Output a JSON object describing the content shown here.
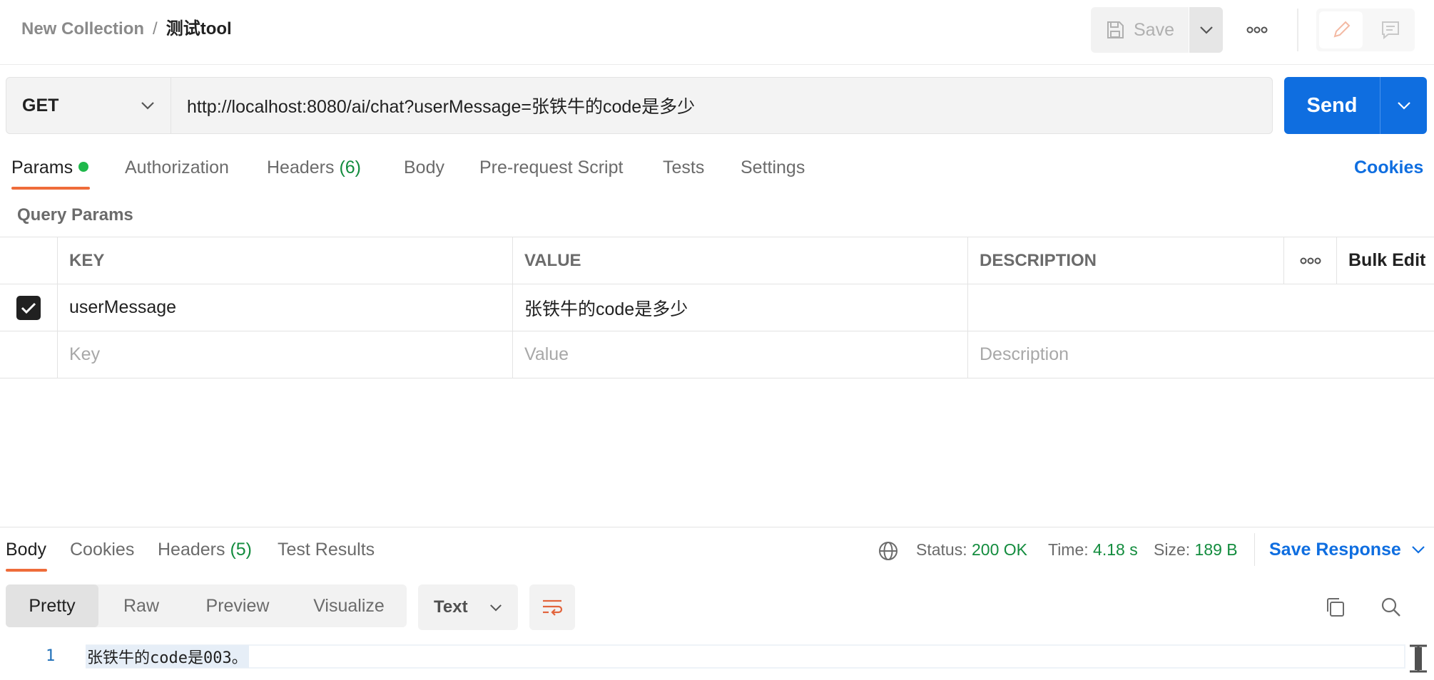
{
  "header": {
    "collection": "New Collection",
    "separator": "/",
    "request_name": "测试tool",
    "save_label": "Save"
  },
  "request": {
    "method": "GET",
    "url": "http://localhost:8080/ai/chat?userMessage=张铁牛的code是多少",
    "send_label": "Send"
  },
  "request_tabs": {
    "params": "Params",
    "authorization": "Authorization",
    "headers": "Headers",
    "headers_count": "(6)",
    "body": "Body",
    "pre_request": "Pre-request Script",
    "tests": "Tests",
    "settings": "Settings",
    "cookies": "Cookies"
  },
  "query_params": {
    "label": "Query Params",
    "columns": {
      "key": "KEY",
      "value": "VALUE",
      "description": "DESCRIPTION",
      "bulk_edit": "Bulk Edit"
    },
    "rows": [
      {
        "checked": true,
        "key": "userMessage",
        "value": "张铁牛的code是多少",
        "description": ""
      }
    ],
    "placeholders": {
      "key": "Key",
      "value": "Value",
      "description": "Description"
    }
  },
  "response_tabs": {
    "body": "Body",
    "cookies": "Cookies",
    "headers": "Headers",
    "headers_count": "(5)",
    "test_results": "Test Results"
  },
  "response_status": {
    "status_label": "Status:",
    "status_value": "200 OK",
    "time_label": "Time:",
    "time_value": "4.18 s",
    "size_label": "Size:",
    "size_value": "189 B",
    "save_response": "Save Response"
  },
  "response_view": {
    "modes": [
      "Pretty",
      "Raw",
      "Preview",
      "Visualize"
    ],
    "format": "Text"
  },
  "response_body": {
    "line_number": "1",
    "line_text": "张铁牛的code是003。"
  },
  "colors": {
    "accent_blue": "#0f6ee0",
    "tab_underline": "#ef6c3a",
    "success_green": "#138c3e"
  }
}
